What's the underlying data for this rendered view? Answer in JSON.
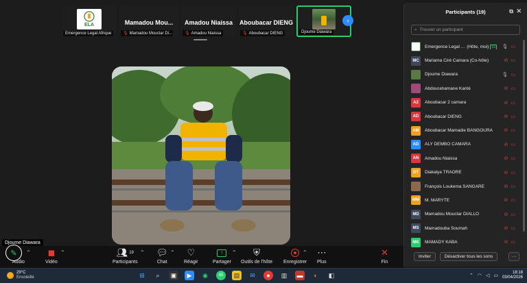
{
  "strip": {
    "tiles": [
      {
        "name": "",
        "caption": "Emergence Legal Afrique",
        "muted": false
      },
      {
        "name": "Mamadou  Mou...",
        "caption": "Mamadou Mouctar Di...",
        "muted": true
      },
      {
        "name": "Amadou Niaissa",
        "caption": "Amadou Niaissa",
        "muted": true
      },
      {
        "name": "Aboubacar DIENG",
        "caption": "Aboubacar DIENG",
        "muted": true
      },
      {
        "name": "",
        "caption": "Djoume Diawara",
        "muted": false
      }
    ],
    "logo_text": "ELA"
  },
  "main": {
    "speaker_name": "Djoume Diawara"
  },
  "toolbar": {
    "audio": "Audio",
    "video": "Vidéo",
    "participants": "Participants",
    "participants_count": "19",
    "chat": "Chat",
    "react": "Réagir",
    "share": "Partager",
    "host_tools": "Outils de l'hôte",
    "record": "Enregistrer",
    "more": "Plus",
    "end": "Fin"
  },
  "panel": {
    "title": "Participants (19)",
    "search_placeholder": "Trouver un participant",
    "participants": [
      {
        "initials": "",
        "name": "Emergence Legal ...",
        "suffix": "(Hôte, moi)",
        "color": "#ffffff",
        "type": "logo"
      },
      {
        "initials": "MC",
        "name": "Mariama Ciré Camara (Co-hôte)",
        "suffix": "",
        "color": "#3e4a5c",
        "type": "initials"
      },
      {
        "initials": "",
        "name": "Djoume Diawara",
        "suffix": "",
        "color": "#5a7a45",
        "type": "photo"
      },
      {
        "initials": "",
        "name": "Abdourahamane Kanté",
        "suffix": "",
        "color": "#a04a7a",
        "type": "photo"
      },
      {
        "initials": "A2",
        "name": "Aboubacar 2 camara",
        "suffix": "",
        "color": "#d9363e",
        "type": "initials"
      },
      {
        "initials": "AD",
        "name": "Aboubacar DIENG",
        "suffix": "",
        "color": "#d9363e",
        "type": "initials"
      },
      {
        "initials": "AM",
        "name": "Aboubacar Mamadie BANGOURA",
        "suffix": "",
        "color": "#f0a020",
        "type": "initials"
      },
      {
        "initials": "AD",
        "name": "ALY DEMBO CAMARA",
        "suffix": "",
        "color": "#2d8cff",
        "type": "initials"
      },
      {
        "initials": "AN",
        "name": "Amadou Niaissa",
        "suffix": "",
        "color": "#d9363e",
        "type": "initials"
      },
      {
        "initials": "DT",
        "name": "Diakalya TRAORE",
        "suffix": "",
        "color": "#f0a020",
        "type": "initials"
      },
      {
        "initials": "",
        "name": "François Loukema SANGARE",
        "suffix": "",
        "color": "#8a6a4a",
        "type": "photo"
      },
      {
        "initials": "MM",
        "name": "M. MARYTE",
        "suffix": "",
        "color": "#f0a020",
        "type": "initials"
      },
      {
        "initials": "MD",
        "name": "Mamadou Mouctar DIALLO",
        "suffix": "",
        "color": "#3e4a5c",
        "type": "initials"
      },
      {
        "initials": "MS",
        "name": "Mamadouba Soumah",
        "suffix": "",
        "color": "#3e4a5c",
        "type": "initials"
      },
      {
        "initials": "MK",
        "name": "MAMADY KABA",
        "suffix": "",
        "color": "#2ecc71",
        "type": "initials"
      }
    ],
    "invite": "Inviter",
    "mute_all": "Désactiver tous les sons",
    "more": "···"
  },
  "taskbar": {
    "temp": "29°C",
    "weather": "Ensoleillé",
    "time": "18:18",
    "date": "03/04/2026",
    "badge": "45"
  }
}
